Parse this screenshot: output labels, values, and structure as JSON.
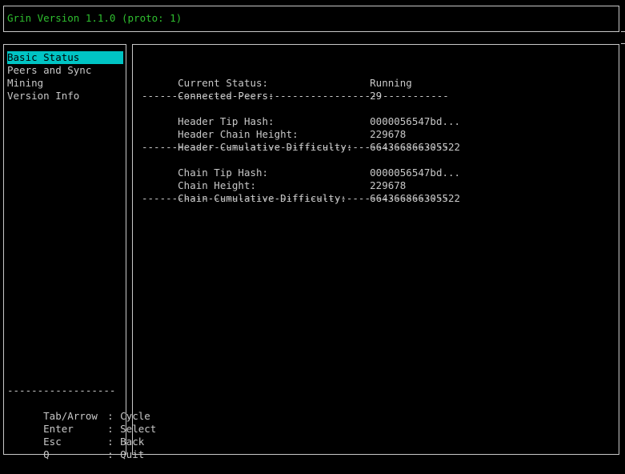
{
  "header": {
    "title": "Grin Version 1.1.0 (proto: 1)"
  },
  "colors": {
    "title": "#2fbf2f",
    "selection": "#00c4c4",
    "text": "#c8c8c8",
    "background": "#000000"
  },
  "menu": {
    "items": [
      "Basic Status",
      "Peers and Sync",
      "Mining",
      "Version Info"
    ],
    "selected": "Basic Status"
  },
  "help": {
    "divider": "------------------",
    "rows": [
      {
        "key": "Tab/Arrow",
        "sep": ":",
        "action": "Cycle"
      },
      {
        "key": "Enter",
        "sep": ":",
        "action": "Select"
      },
      {
        "key": "Esc",
        "sep": ":",
        "action": "Back"
      },
      {
        "key": "Q",
        "sep": ":",
        "action": "Quit"
      }
    ]
  },
  "status": {
    "divider": "---------------------------------------------------",
    "current_status": {
      "label": "Current Status:",
      "value": "Running"
    },
    "connected_peers": {
      "label": "Connected Peers:",
      "value": "29"
    },
    "header_tip_hash": {
      "label": "Header Tip Hash:",
      "value": "0000056547bd..."
    },
    "header_chain_height": {
      "label": "Header Chain Height:",
      "value": "229678"
    },
    "header_cumulative_difficulty": {
      "label": "Header Cumulative Difficulty:",
      "value": "664366866305522"
    },
    "chain_tip_hash": {
      "label": "Chain Tip Hash:",
      "value": "0000056547bd..."
    },
    "chain_height": {
      "label": "Chain Height:",
      "value": "229678"
    },
    "chain_cumulative_difficulty": {
      "label": "Chain Cumulative Difficulty:",
      "value": "664366866305522"
    }
  }
}
